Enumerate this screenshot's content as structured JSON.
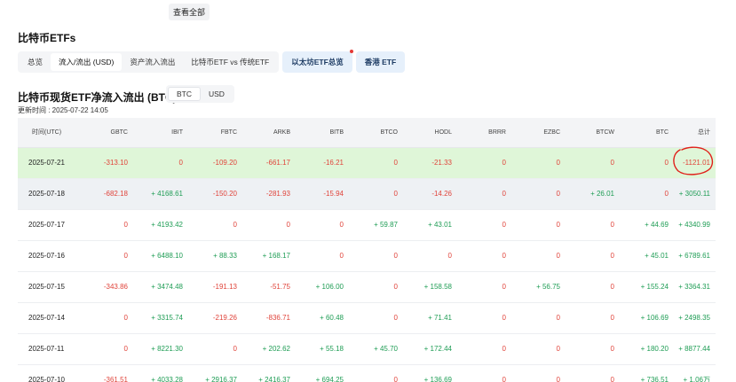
{
  "header": {
    "view_all_label": "查看全部"
  },
  "section": {
    "title": "比特币ETFs"
  },
  "tabs": [
    {
      "label": "总览",
      "active": false
    },
    {
      "label": "流入/流出 (USD)",
      "active": true
    },
    {
      "label": "资产流入流出",
      "active": false
    },
    {
      "label": "比特币ETF vs 传统ETF",
      "active": false
    }
  ],
  "alt_tabs": [
    {
      "label": "以太坊ETF总览",
      "has_dot": true
    },
    {
      "label": "香港 ETF",
      "has_dot": false
    }
  ],
  "main": {
    "title": "比特币现货ETF净流入流出 (BTC)",
    "unit_options": [
      "BTC",
      "USD"
    ],
    "unit_selected": "BTC",
    "updated": "更新时间 : 2025-07-22 14:05"
  },
  "table": {
    "columns": [
      "时间(UTC)",
      "GBTC",
      "IBIT",
      "FBTC",
      "ARKB",
      "BITB",
      "BTCO",
      "HODL",
      "BRRR",
      "EZBC",
      "BTCW",
      "BTC",
      "总计"
    ],
    "rows": [
      [
        "2025-07-21",
        "-313.10",
        "0",
        "-109.20",
        "-661.17",
        "-16.21",
        "0",
        "-21.33",
        "0",
        "0",
        "0",
        "0",
        "-1121.01"
      ],
      [
        "2025-07-18",
        "-682.18",
        "+ 4168.61",
        "-150.20",
        "-281.93",
        "-15.94",
        "0",
        "-14.26",
        "0",
        "0",
        "+ 26.01",
        "0",
        "+ 3050.11"
      ],
      [
        "2025-07-17",
        "0",
        "+ 4193.42",
        "0",
        "0",
        "0",
        "+ 59.87",
        "+ 43.01",
        "0",
        "0",
        "0",
        "+ 44.69",
        "+ 4340.99"
      ],
      [
        "2025-07-16",
        "0",
        "+ 6488.10",
        "+ 88.33",
        "+ 168.17",
        "0",
        "0",
        "0",
        "0",
        "0",
        "0",
        "+ 45.01",
        "+ 6789.61"
      ],
      [
        "2025-07-15",
        "-343.86",
        "+ 3474.48",
        "-191.13",
        "-51.75",
        "+ 106.00",
        "0",
        "+ 158.58",
        "0",
        "+ 56.75",
        "0",
        "+ 155.24",
        "+ 3364.31"
      ],
      [
        "2025-07-14",
        "0",
        "+ 3315.74",
        "-219.26",
        "-836.71",
        "+ 60.48",
        "0",
        "+ 71.41",
        "0",
        "0",
        "0",
        "+ 106.69",
        "+ 2498.35"
      ],
      [
        "2025-07-11",
        "0",
        "+ 8221.30",
        "0",
        "+ 202.62",
        "+ 55.18",
        "+ 45.70",
        "+ 172.44",
        "0",
        "0",
        "0",
        "+ 180.20",
        "+ 8877.44"
      ],
      [
        "2025-07-10",
        "-361.51",
        "+ 4033.28",
        "+ 2916.37",
        "+ 2416.37",
        "+ 694.25",
        "0",
        "+ 136.69",
        "0",
        "0",
        "0",
        "+ 736.51",
        "+ 1.06万"
      ]
    ]
  },
  "colors": {
    "negative": "#e0443b",
    "positive": "#1f9d55",
    "highlight_row": "#dff6d8",
    "annotation": "#e0201a"
  }
}
